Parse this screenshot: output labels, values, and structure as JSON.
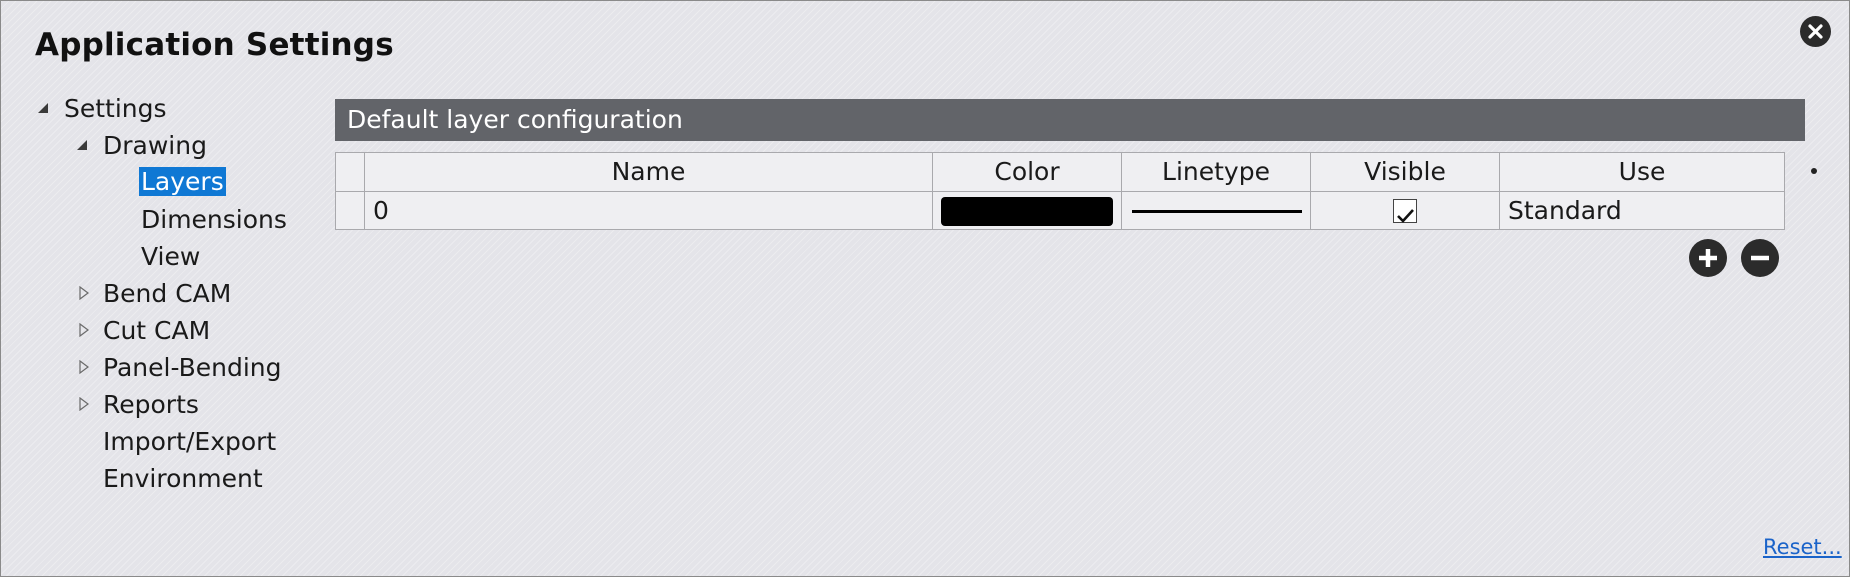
{
  "window": {
    "title": "Application Settings",
    "close_icon": "close-icon"
  },
  "tree": {
    "settings": "Settings",
    "drawing": "Drawing",
    "layers": "Layers",
    "dimensions": "Dimensions",
    "view": "View",
    "bend_cam": "Bend CAM",
    "cut_cam": "Cut CAM",
    "panel_bending": "Panel-Bending",
    "reports": "Reports",
    "import_export": "Import/Export",
    "environment": "Environment",
    "selected": "Layers"
  },
  "panel": {
    "header": "Default layer configuration"
  },
  "grid": {
    "columns": [
      "Name",
      "Color",
      "Linetype",
      "Visible",
      "Use"
    ],
    "rows": [
      {
        "name": "0",
        "color": "#000000",
        "linetype": "solid",
        "visible": true,
        "use": "Standard"
      }
    ]
  },
  "buttons": {
    "add_icon": "plus-circle-icon",
    "remove_icon": "minus-circle-icon"
  },
  "footer": {
    "reset": "Reset..."
  },
  "colors": {
    "header_bg": "#626469",
    "selection": "#0f78d4",
    "link": "#1a63c9"
  }
}
